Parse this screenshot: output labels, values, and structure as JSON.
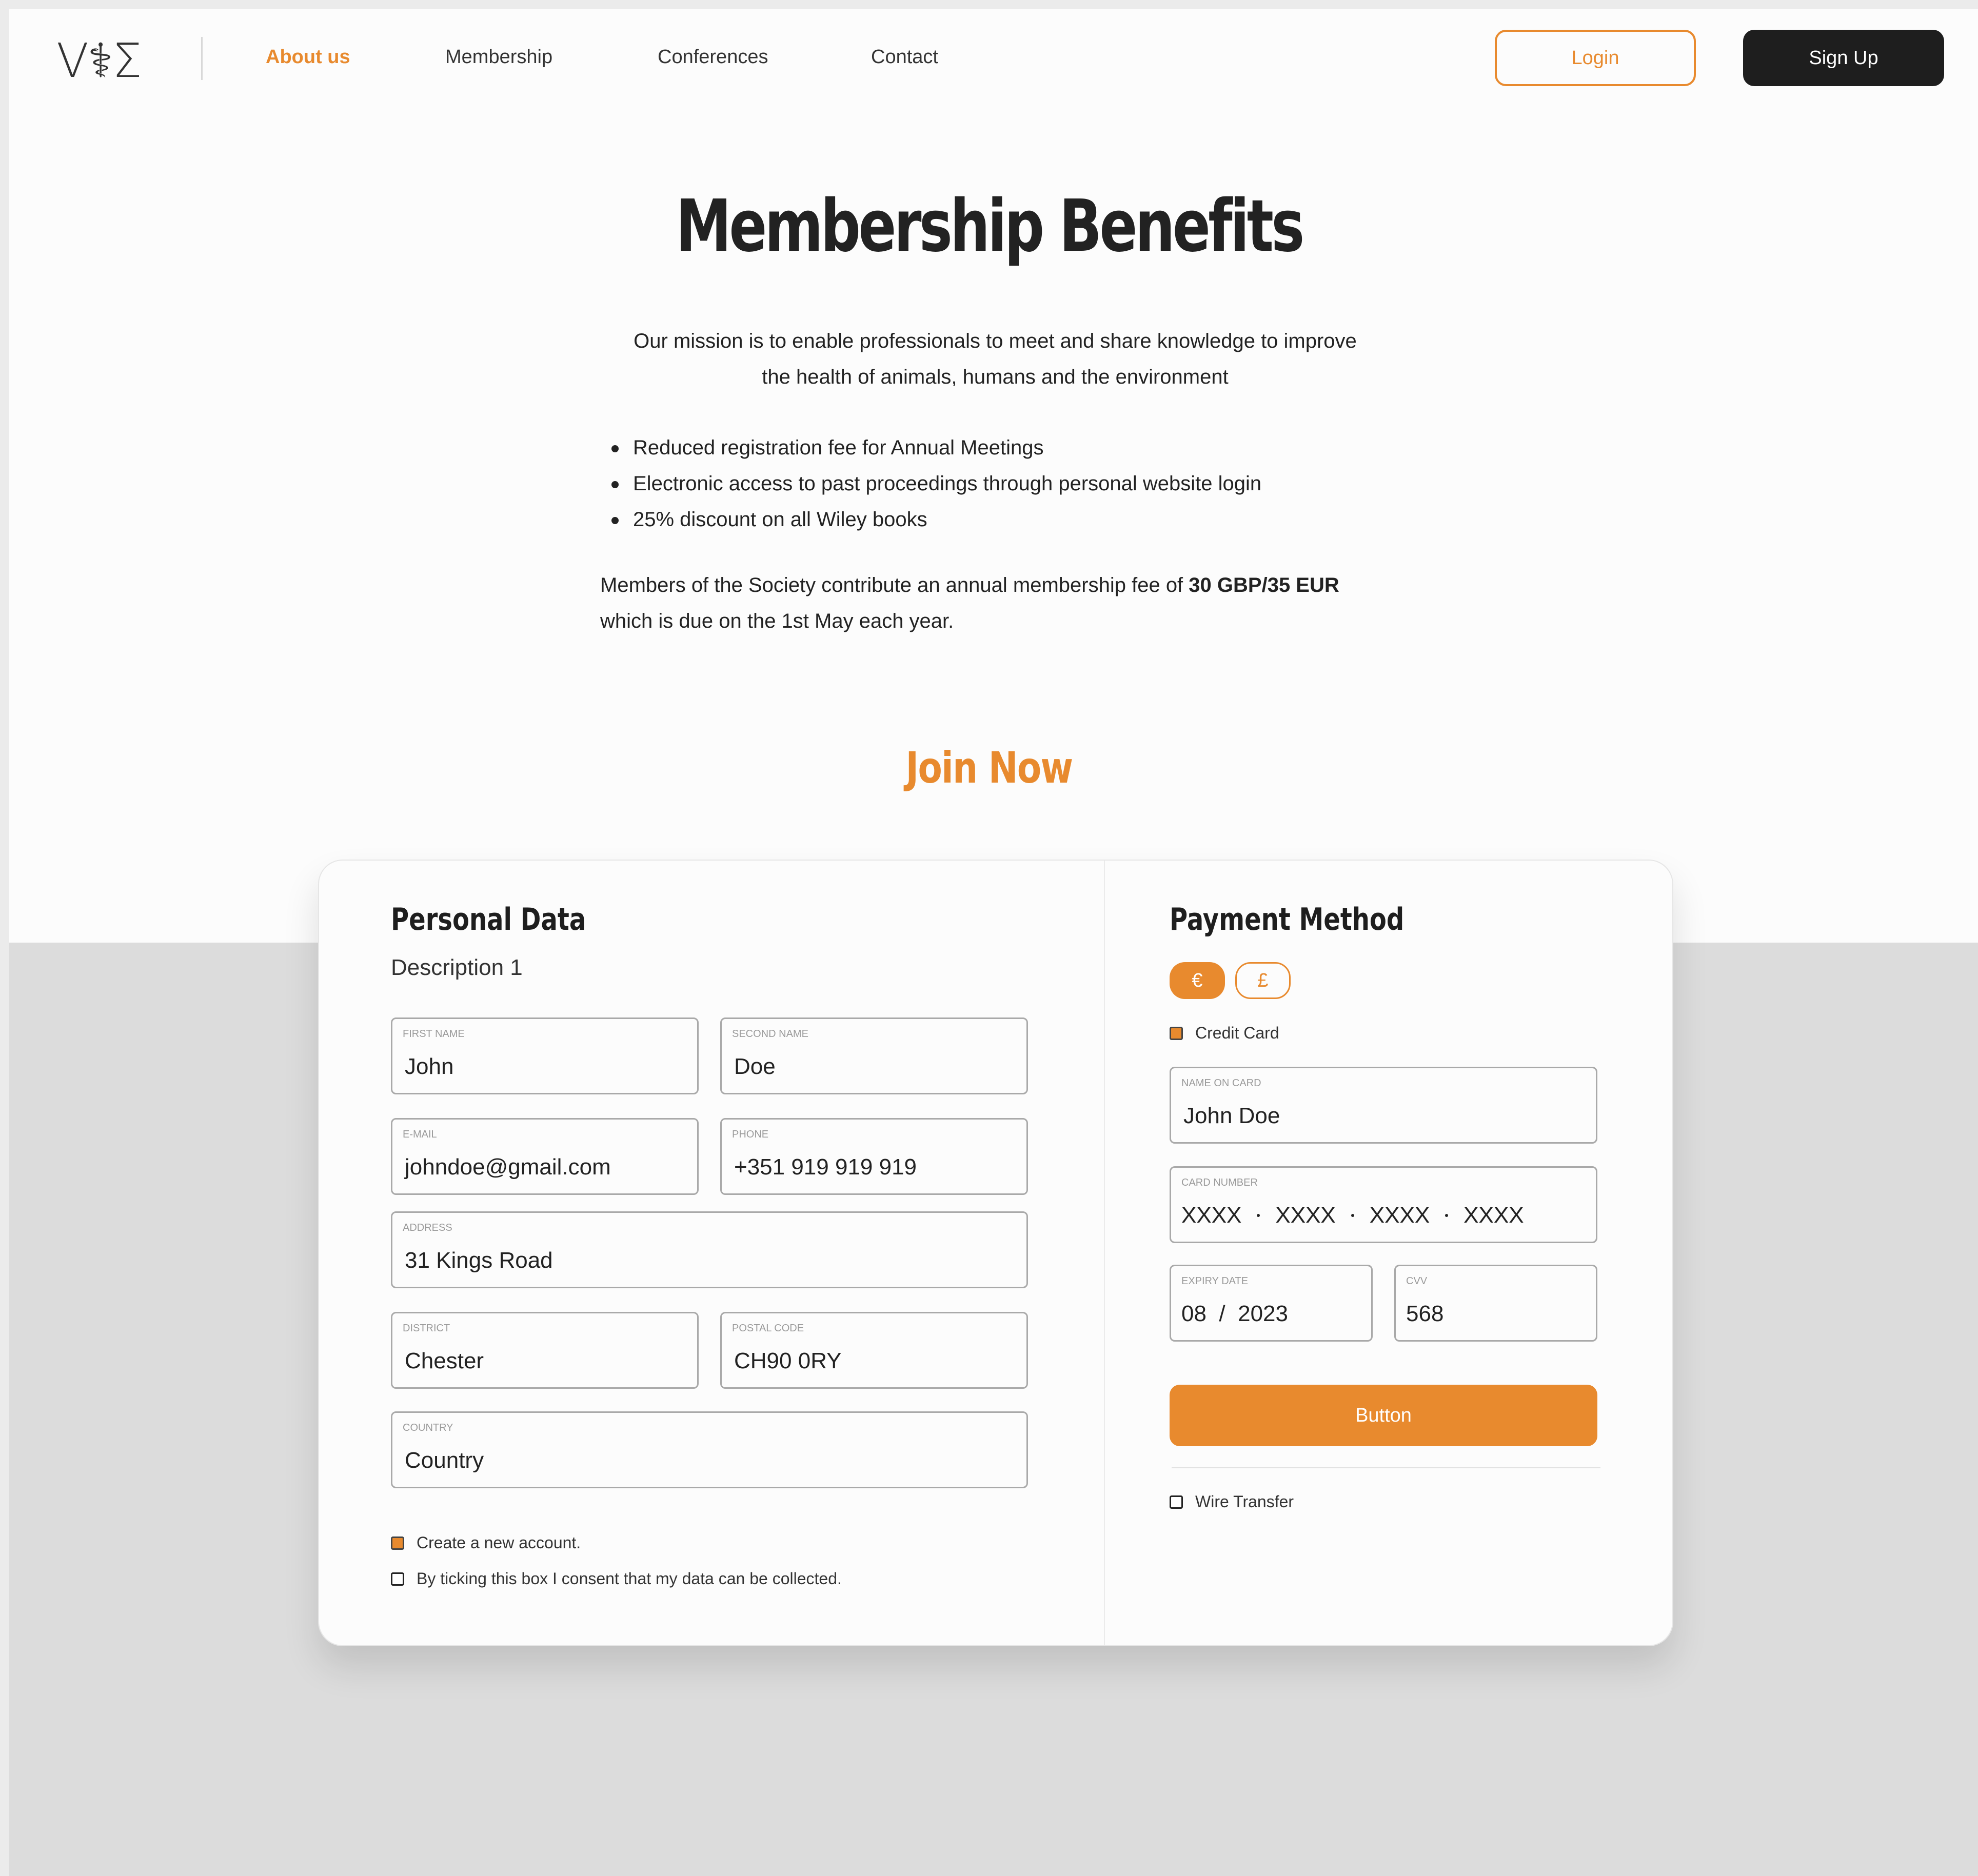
{
  "nav": {
    "logo": "V⚕Σ",
    "links": [
      "About us",
      "Membership",
      "Conferences",
      "Contact"
    ],
    "active_index": 0,
    "login_label": "Login",
    "signup_label": "Sign Up"
  },
  "hero": {
    "title": "Membership Benefits",
    "mission_line1": "Our mission is to enable professionals to meet and share knowledge to improve",
    "mission_line2": "the health of animals, humans and the environment",
    "benefits": [
      "Reduced registration fee for Annual Meetings",
      "Electronic access to past proceedings through personal website login",
      "25% discount on all Wiley books"
    ],
    "fee_prefix": "Members of the Society contribute an annual membership fee of ",
    "fee_amount": "30 GBP/35 EUR",
    "fee_suffix": "which is due on the 1st May each year."
  },
  "join": {
    "title": "Join Now"
  },
  "personal": {
    "title": "Personal Data",
    "description": "Description 1",
    "fields": {
      "first_name": {
        "label": "FIRST NAME",
        "value": "John"
      },
      "second_name": {
        "label": "SECOND NAME",
        "value": "Doe"
      },
      "email": {
        "label": "E-MAIL",
        "value": "johndoe@gmail.com"
      },
      "phone": {
        "label": "PHONE",
        "value": "+351 919 919 919"
      },
      "address": {
        "label": "ADDRESS",
        "value": "31 Kings Road"
      },
      "district": {
        "label": "DISTRICT",
        "value": "Chester"
      },
      "postal_code": {
        "label": "POSTAL CODE",
        "value": "CH90 0RY"
      },
      "country": {
        "label": "COUNTRY",
        "value": "Country"
      }
    },
    "create_account_label": "Create a new account.",
    "create_account_checked": true,
    "consent_label": "By ticking this box I consent that my data can be collected.",
    "consent_checked": false
  },
  "payment": {
    "title": "Payment Method",
    "currencies": [
      "€",
      "£"
    ],
    "selected_currency": "€",
    "credit_card_label": "Credit Card",
    "credit_card_checked": true,
    "name_on_card": {
      "label": "NAME ON CARD",
      "value": "John Doe"
    },
    "card_number": {
      "label": "CARD NUMBER",
      "groups": [
        "XXXX",
        "XXXX",
        "XXXX",
        "XXXX"
      ]
    },
    "expiry": {
      "label": "EXPIRY DATE",
      "month": "08",
      "separator": "/",
      "year": "2023"
    },
    "cvv": {
      "label": "CVV",
      "value": "568"
    },
    "button_label": "Button",
    "wire_transfer_label": "Wire Transfer",
    "wire_transfer_checked": false
  },
  "colors": {
    "accent": "#e88a2e",
    "dark": "#1e1e1e",
    "background_top": "#fcfcfc",
    "background_bottom": "#dcdcdc"
  }
}
